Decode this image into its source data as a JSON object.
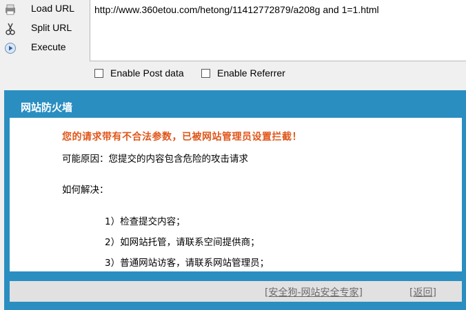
{
  "toolbar": {
    "load_label": "Load URL",
    "split_label": "Split URL",
    "execute_label": "Execute",
    "url_value": "http://www.360etou.com/hetong/11412772879/a208g and 1=1.html",
    "enable_post_label": "Enable Post data",
    "enable_referrer_label": "Enable Referrer"
  },
  "firewall": {
    "title": "网站防火墙",
    "warning": "您的请求带有不合法参数，已被网站管理员设置拦截！",
    "reason": "可能原因：您提交的内容包含危险的攻击请求",
    "how_to": "如何解决：",
    "steps": [
      "1）检查提交内容；",
      "2）如网站托管，请联系空间提供商；",
      "3）普通网站访客，请联系网站管理员；"
    ],
    "footer_link_safe": "[安全狗-网站安全专家]",
    "footer_link_back": "[返回]"
  }
}
